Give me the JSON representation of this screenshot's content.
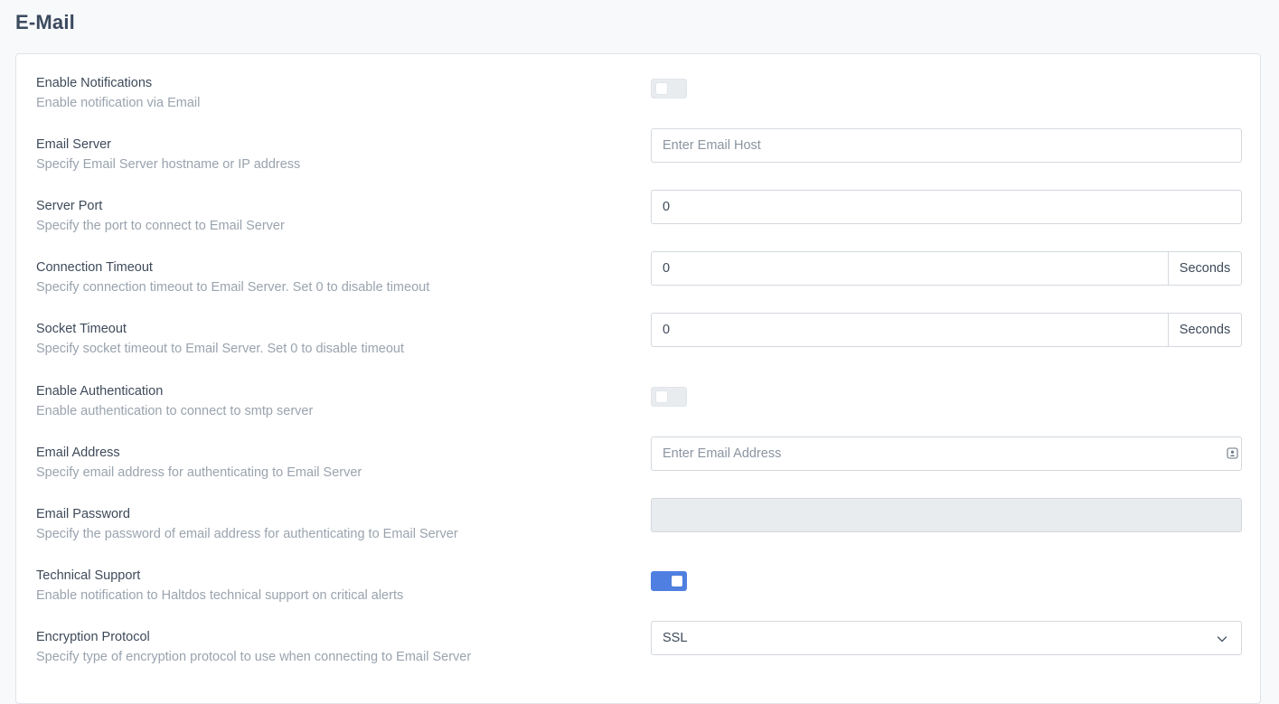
{
  "page": {
    "title": "E-Mail"
  },
  "settings": {
    "enable_notifications": {
      "label": "Enable Notifications",
      "description": "Enable notification via Email",
      "enabled": false
    },
    "email_server": {
      "label": "Email Server",
      "description": "Specify Email Server hostname or IP address",
      "value": "",
      "placeholder": "Enter Email Host"
    },
    "server_port": {
      "label": "Server Port",
      "description": "Specify the port to connect to Email Server",
      "value": "0"
    },
    "connection_timeout": {
      "label": "Connection Timeout",
      "description": "Specify connection timeout to Email Server. Set 0 to disable timeout",
      "value": "0",
      "unit": "Seconds"
    },
    "socket_timeout": {
      "label": "Socket Timeout",
      "description": "Specify socket timeout to Email Server. Set 0 to disable timeout",
      "value": "0",
      "unit": "Seconds"
    },
    "enable_authentication": {
      "label": "Enable Authentication",
      "description": "Enable authentication to connect to smtp server",
      "enabled": false
    },
    "email_address": {
      "label": "Email Address",
      "description": "Specify email address for authenticating to Email Server",
      "value": "",
      "placeholder": "Enter Email Address",
      "icon": "autofill-contact-icon"
    },
    "email_password": {
      "label": "Email Password",
      "description": "Specify the password of email address for authenticating to Email Server",
      "value": "",
      "disabled": true
    },
    "technical_support": {
      "label": "Technical Support",
      "description": "Enable notification to Haltdos technical support on critical alerts",
      "enabled": true
    },
    "encryption_protocol": {
      "label": "Encryption Protocol",
      "description": "Specify type of encryption protocol to use when connecting to Email Server",
      "selected": "SSL",
      "icon": "chevron-down-icon"
    }
  },
  "colors": {
    "accent": "#4f80e1",
    "title": "#3b4a5e",
    "label": "#3e4a5a",
    "description": "#9aa3ae",
    "disabled_bg": "#e9ecef"
  }
}
